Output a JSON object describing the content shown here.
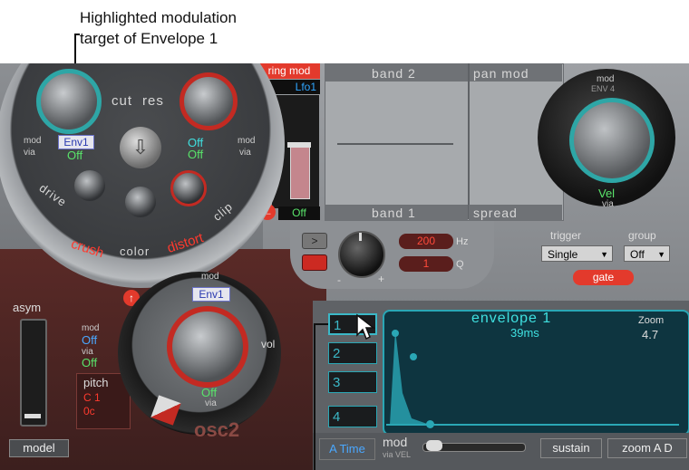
{
  "annotations": {
    "callout_line1": "Highlighted modulation",
    "callout_line2": "target of Envelope 1"
  },
  "filter": {
    "cut_label": "cut",
    "res_label": "res",
    "mod_left": "mod",
    "via_left": "via",
    "mod_right": "mod",
    "via_right": "via",
    "env_target": "Env1",
    "left_via_value": "Off",
    "right_mod_value": "Off",
    "right_via_value": "Off",
    "drive_label": "drive",
    "clip_label": "clip",
    "crush_label": "crush",
    "color_label": "color",
    "distort_label": "distort"
  },
  "ringmod": {
    "title": "ring mod",
    "source": "Lfo1",
    "off_value": "Off"
  },
  "bands": {
    "band2": "band 2",
    "band1": "band 1",
    "pan_mod": "pan mod",
    "spread": "spread",
    "hz_value": "200",
    "hz_unit": "Hz",
    "q_value": "1",
    "q_unit": "Q",
    "knob_minus": "-",
    "knob_plus": "+"
  },
  "panknob": {
    "mod": "mod",
    "env": "ENV 4",
    "via_value": "Vel",
    "via": "via"
  },
  "trigger": {
    "trigger_label": "trigger",
    "trigger_value": "Single",
    "group_label": "group",
    "group_value": "Off",
    "gate_label": "gate"
  },
  "osc2": {
    "mod": "mod",
    "env_target": "Env1",
    "via_value": "Off",
    "via": "via",
    "vol_label": "vol",
    "name": "osc2",
    "asym_label": "asym",
    "model_label": "model",
    "left_mod": "mod",
    "left_mod_value": "Off",
    "left_via": "via",
    "left_via_value": "Off",
    "pitch_label": "pitch",
    "pitch_c": "C 1",
    "pitch_0c": "0c"
  },
  "envelope": {
    "title": "envelope 1",
    "time": "39ms",
    "zoom_label": "Zoom",
    "zoom_value": "4.7",
    "slots": [
      "1",
      "2",
      "3",
      "4"
    ],
    "a_time": "A Time",
    "mod_label": "mod",
    "via_vel": "via VEL",
    "sustain": "sustain",
    "zoom_ad": "zoom A D"
  }
}
